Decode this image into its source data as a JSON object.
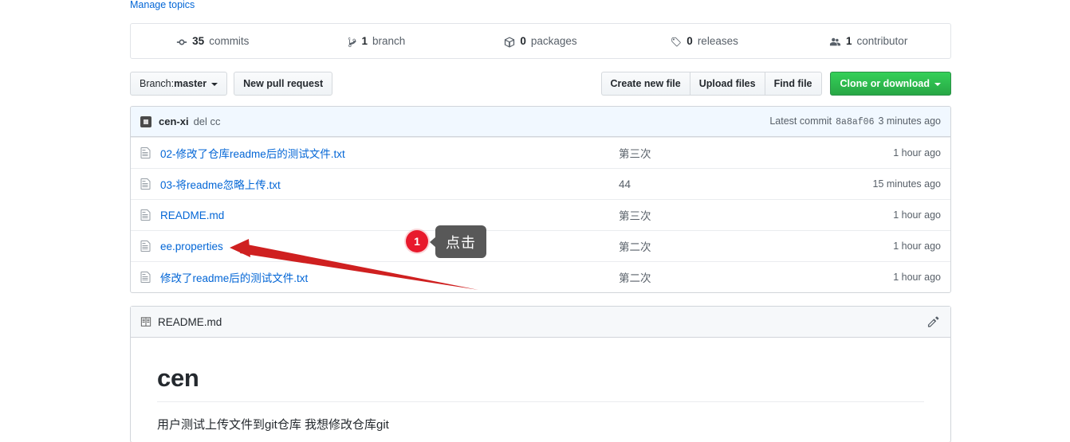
{
  "topics": {
    "manage_label": "Manage topics"
  },
  "stats": [
    {
      "icon": "git-commit-icon",
      "num": "35",
      "label": "commits",
      "name": "stat-commits"
    },
    {
      "icon": "branch-icon",
      "num": "1",
      "label": "branch",
      "name": "stat-branches"
    },
    {
      "icon": "package-icon",
      "num": "0",
      "label": "packages",
      "name": "stat-packages"
    },
    {
      "icon": "tag-icon",
      "num": "0",
      "label": "releases",
      "name": "stat-releases"
    },
    {
      "icon": "people-icon",
      "num": "1",
      "label": "contributor",
      "name": "stat-contributors"
    }
  ],
  "toolbar": {
    "branch_prefix": "Branch: ",
    "branch_name": "master",
    "new_pull_request": "New pull request",
    "create_new_file": "Create new file",
    "upload_files": "Upload files",
    "find_file": "Find file",
    "clone_or_download": "Clone or download"
  },
  "commit_header": {
    "author": "cen-xi",
    "message": "del cc",
    "latest_label": "Latest commit",
    "sha": "8a8af06",
    "age": "3 minutes ago"
  },
  "files": [
    {
      "icon": "file-icon",
      "name": "02-修改了仓库readme后的测试文件.txt",
      "message": "第三次",
      "age": "1 hour ago"
    },
    {
      "icon": "file-icon",
      "name": "03-将readme忽略上传.txt",
      "message": "44",
      "age": "15 minutes ago"
    },
    {
      "icon": "file-icon",
      "name": "README.md",
      "message": "第三次",
      "age": "1 hour ago"
    },
    {
      "icon": "file-icon",
      "name": "ee.properties",
      "message": "第二次",
      "age": "1 hour ago"
    },
    {
      "icon": "file-icon",
      "name": "修改了readme后的测试文件.txt",
      "message": "第二次",
      "age": "1 hour ago"
    }
  ],
  "readme": {
    "title": "README.md",
    "heading": "cen",
    "paragraph": "用户测试上传文件到git仓库 我想修改仓库git"
  },
  "annotation": {
    "step_number": "1",
    "tooltip": "点击",
    "target_file": "ee.properties",
    "arrow_color": "#d62728",
    "badge_color": "#e8192c",
    "tooltip_color": "#585858"
  },
  "colors": {
    "link": "#0366d6",
    "green_button": "#28a745",
    "text": "#24292e",
    "muted": "#586069",
    "border": "#d1d5da"
  }
}
